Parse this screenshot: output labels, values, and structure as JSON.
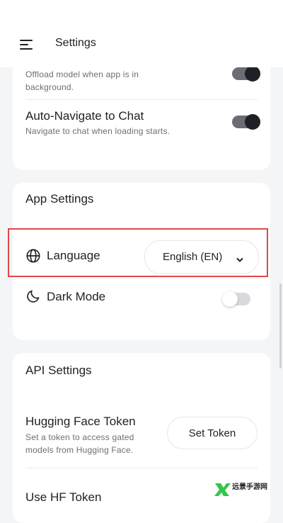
{
  "header": {
    "title": "Settings",
    "menu_icon": "menu-icon"
  },
  "model_settings": {
    "offload": {
      "description": "Offload model when app is in background.",
      "enabled": true
    },
    "auto_navigate": {
      "title": "Auto-Navigate to Chat",
      "description": "Navigate to chat when loading starts.",
      "enabled": true
    }
  },
  "app_settings": {
    "title": "App Settings",
    "language": {
      "label": "Language",
      "value": "English (EN)",
      "icon": "globe-icon"
    },
    "dark_mode": {
      "label": "Dark Mode",
      "enabled": false,
      "icon": "moon-icon"
    }
  },
  "api_settings": {
    "title": "API Settings",
    "hf_token": {
      "title": "Hugging Face Token",
      "description": "Set a token to access gated models from Hugging Face.",
      "button_label": "Set Token"
    },
    "use_hf_token": {
      "title": "Use HF Token"
    }
  },
  "watermark": {
    "text": "远景手游网"
  },
  "colors": {
    "highlight": "#e04848",
    "toggle_on": "#1f2024",
    "toggle_off": "#d9dadd",
    "background": "#f4f5f7"
  }
}
